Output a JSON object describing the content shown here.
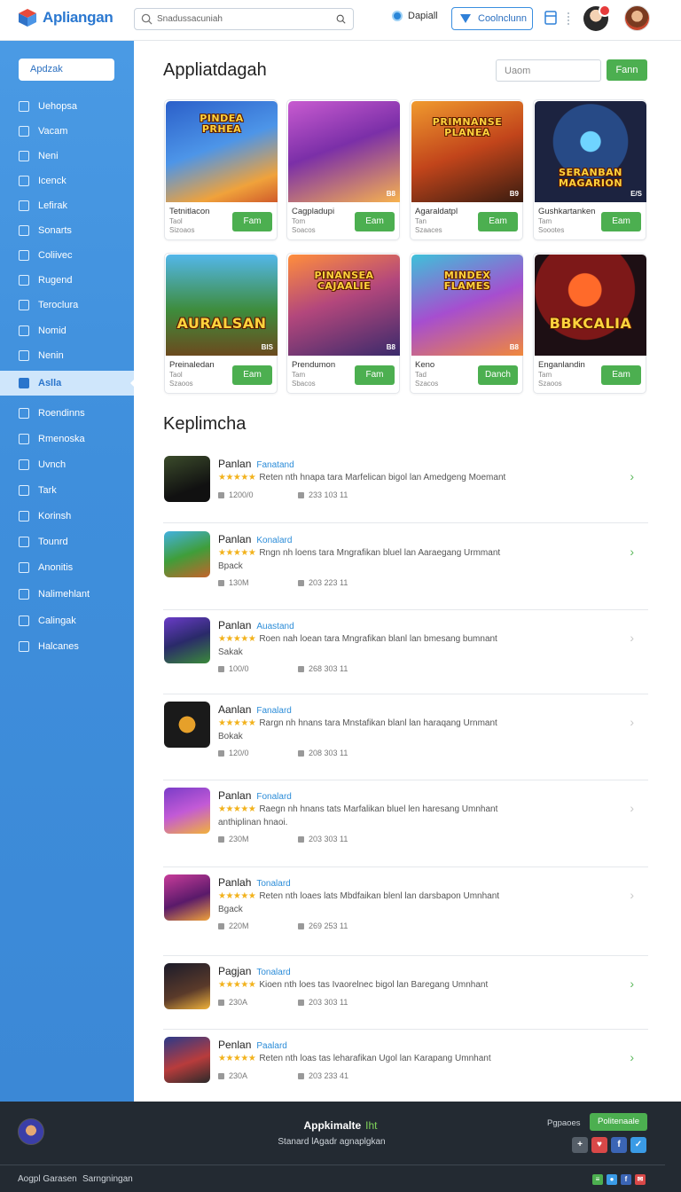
{
  "header": {
    "app_name": "Apliangan",
    "search_placeholder": "Snadussacuniah",
    "link_label": "Dapiall",
    "button_label": "Coolnclunn"
  },
  "sidebar": {
    "search_label": "Apdzak",
    "items": [
      {
        "label": "Uehopsa",
        "icon": "folder-icon"
      },
      {
        "label": "Vacam",
        "icon": "grid-icon"
      },
      {
        "label": "Neni",
        "icon": "box-icon"
      },
      {
        "label": "Icenck",
        "icon": "search-icon"
      },
      {
        "label": "Lefirak",
        "icon": "tag-icon"
      },
      {
        "label": "Sonarts",
        "icon": "home-icon"
      },
      {
        "label": "Coliivec",
        "icon": "box-icon"
      },
      {
        "label": "Rugend",
        "icon": "shield-icon"
      },
      {
        "label": "Teroclura",
        "icon": "heart-icon"
      },
      {
        "label": "Nomid",
        "icon": "user-icon"
      },
      {
        "label": "Nenin",
        "icon": "mail-icon"
      },
      {
        "label": "Aslla",
        "icon": "app-icon",
        "active": true
      },
      {
        "label": "Roendinns",
        "icon": "box-icon"
      },
      {
        "label": "Rmenoska",
        "icon": "folder-icon"
      },
      {
        "label": "Uvnch",
        "icon": "monitor-icon"
      },
      {
        "label": "Tark",
        "icon": "search-icon"
      },
      {
        "label": "Korinsh",
        "icon": "folder-icon"
      },
      {
        "label": "Tounrd",
        "icon": "link-icon"
      },
      {
        "label": "Anonitis",
        "icon": "tag-icon"
      },
      {
        "label": "Nalimehlant",
        "icon": "chat-icon"
      },
      {
        "label": "Calingak",
        "icon": "layers-icon"
      },
      {
        "label": "Halcanes",
        "icon": "window-icon"
      }
    ]
  },
  "main": {
    "section1_title": "Appliatdagah",
    "filter_placeholder": "Uaom",
    "filter_button": "Fann",
    "cards": [
      {
        "name": "Tetnitlacon",
        "sub1": "Taol",
        "sub2": "Sizoaos",
        "button": "Fam",
        "art_title": "PINDEA\nPRHEA",
        "badge": "",
        "palette": "c1"
      },
      {
        "name": "Cagpladupi",
        "sub1": "Tom",
        "sub2": "Soacos",
        "button": "Eam",
        "art_title": "",
        "badge": "B8",
        "palette": "c2"
      },
      {
        "name": "Agaraldatpl",
        "sub1": "Tan",
        "sub2": "Szaaces",
        "button": "Eam",
        "art_title": "PRIMNANSE\nPLANEA",
        "badge": "B9",
        "palette": "c3"
      },
      {
        "name": "Gushkartanken",
        "sub1": "Tam",
        "sub2": "Soootes",
        "button": "Eam",
        "art_title": "SERANBAN\nMAGARION",
        "badge": "E/S",
        "palette": "c4"
      },
      {
        "name": "Preinaledan",
        "sub1": "Taol",
        "sub2": "Szaoos",
        "button": "Eam",
        "art_title": "AURALSAN",
        "badge": "BIS",
        "palette": "c5"
      },
      {
        "name": "Prendumon",
        "sub1": "Tam",
        "sub2": "Sbacos",
        "button": "Fam",
        "art_title": "PINANSEA\nCAJAALIE",
        "badge": "B8",
        "palette": "c6"
      },
      {
        "name": "Keno",
        "sub1": "Tad",
        "sub2": "Szacos",
        "button": "Danch",
        "art_title": "MINDEX\nFLAMES",
        "badge": "B8",
        "palette": "c7"
      },
      {
        "name": "Enganlandin",
        "sub1": "Tam",
        "sub2": "Szaoos",
        "button": "Eam",
        "art_title": "BBKCALIA",
        "badge": "",
        "palette": "c8"
      }
    ],
    "section2_title": "Keplimcha",
    "rows": [
      {
        "title": "Panlan",
        "tag": "Fanatand",
        "desc": "Reten nth hnapa tara Marfelican bigol lan Amedgeng Moemant",
        "sub": "",
        "m1": "1200/0",
        "m2": "233 103 11",
        "chev": "#5cb85c",
        "thumb": "t1"
      },
      {
        "title": "Panlan",
        "tag": "Konalard",
        "desc": "Rngn nh loens tara Mngrafikan bluel lan Aaraegang Urmmant",
        "sub": "Bpack",
        "m1": "130M",
        "m2": "203 223 11",
        "chev": "#5cb85c",
        "thumb": "t2"
      },
      {
        "title": "Panlan",
        "tag": "Auastand",
        "desc": "Roen nah loean tara Mngrafikan blanl lan bmesang bumnant",
        "sub": "Sakak",
        "m1": "100/0",
        "m2": "268 303 11",
        "chev": "#c8c8c8",
        "thumb": "t3"
      },
      {
        "title": "Aanlan",
        "tag": "Fanalard",
        "desc": "Rargn nh hnans tara Mnstafikan blanl lan haraqang Urnmant",
        "sub": "Bokak",
        "m1": "120/0",
        "m2": "208 303 11",
        "chev": "#c8c8c8",
        "thumb": "t4"
      },
      {
        "title": "Panlan",
        "tag": "Fonalard",
        "desc": "Raegn nh hnans tats Marfalikan bluel len haresang Umnhant",
        "sub": "anthiplinan hnaoi.",
        "m1": "230M",
        "m2": "203 303 11",
        "chev": "#c8c8c8",
        "thumb": "t5"
      },
      {
        "title": "Panlah",
        "tag": "Tonalard",
        "desc": "Reten nth loaes lats Mbdfaikan blenl lan darsbapon Umnhant",
        "sub": "Bgack",
        "m1": "220M",
        "m2": "269 253 11",
        "chev": "#c8c8c8",
        "thumb": "t6"
      },
      {
        "title": "Pagjan",
        "tag": "Tonalard",
        "desc": "Kioen nth loes tas Ivaorelnec bigol lan Baregang Umnhant",
        "sub": "",
        "m1": "230A",
        "m2": "203 303 11",
        "chev": "#5cb85c",
        "thumb": "t7"
      },
      {
        "title": "Penlan",
        "tag": "Paalard",
        "desc": "Reten nth loas tas leharafikan Ugol lan Karapang Umnhant",
        "sub": "",
        "m1": "230A",
        "m2": "203 233 41",
        "chev": "#5cb85c",
        "thumb": "t8"
      }
    ]
  },
  "footer": {
    "title": "Appkimalte",
    "title_highlight": "Iht",
    "subtitle": "Stanard lAgadr agnaplgkan",
    "label": "Pgpaoes",
    "button": "Politenaale",
    "links": [
      "Aogpl Garasen",
      "Sarngningan"
    ]
  },
  "colors": {
    "accent_blue": "#3f8fdc",
    "accent_green": "#4caf50",
    "footer_bg": "#232a32"
  }
}
